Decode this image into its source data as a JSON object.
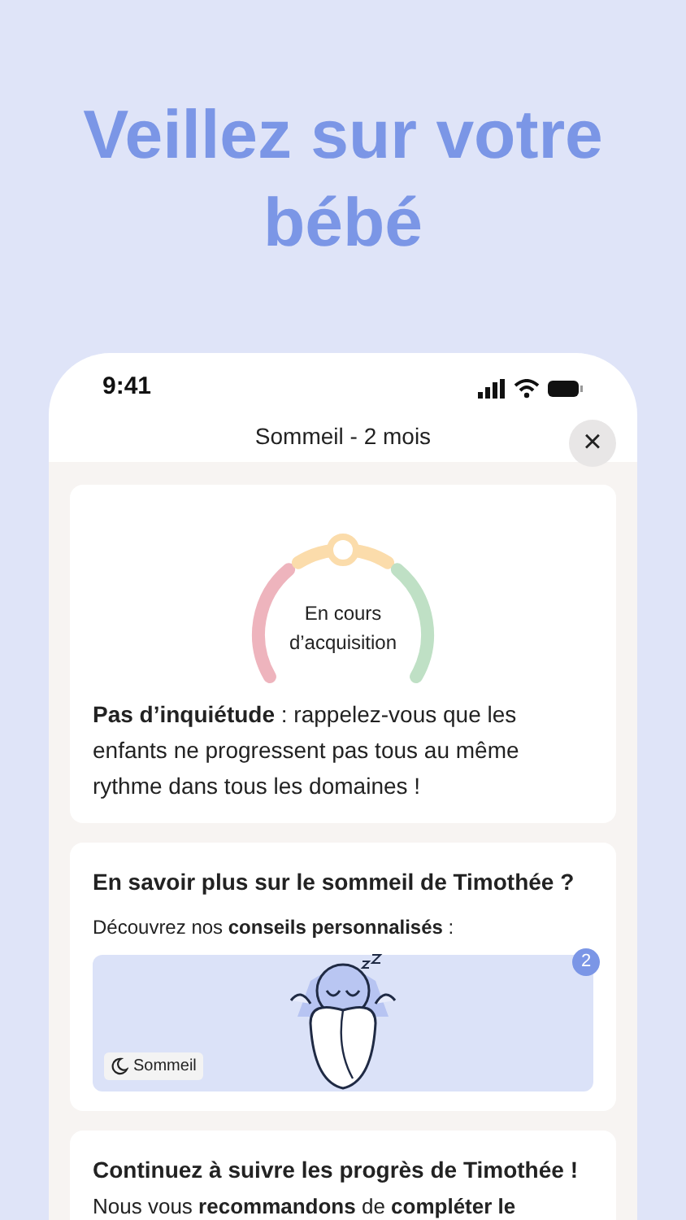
{
  "headline": "Veillez sur votre bébé",
  "status_bar": {
    "time": "9:41"
  },
  "header": {
    "title": "Sommeil - 2 mois",
    "close": "×"
  },
  "status_card": {
    "gauge": {
      "label": "En cours d’acquisition"
    },
    "message": "**Pas d’inquiétude** : rappelez-vous que les enfants ne progressent pas tous au même rythme dans tous les domaines !"
  },
  "advice_card": {
    "title": "En savoir plus sur le sommeil de Timothée ?",
    "subtitle": "Découvrez nos **conseils personnalisés** :",
    "tile": {
      "kind": "picture",
      "badge": "2",
      "tag": "Sommeil"
    }
  },
  "progress_card": {
    "title": "Continuez à suivre les progrès de Timothée !",
    "text": "Nous vous **recommandons** de **compléter le**"
  }
}
